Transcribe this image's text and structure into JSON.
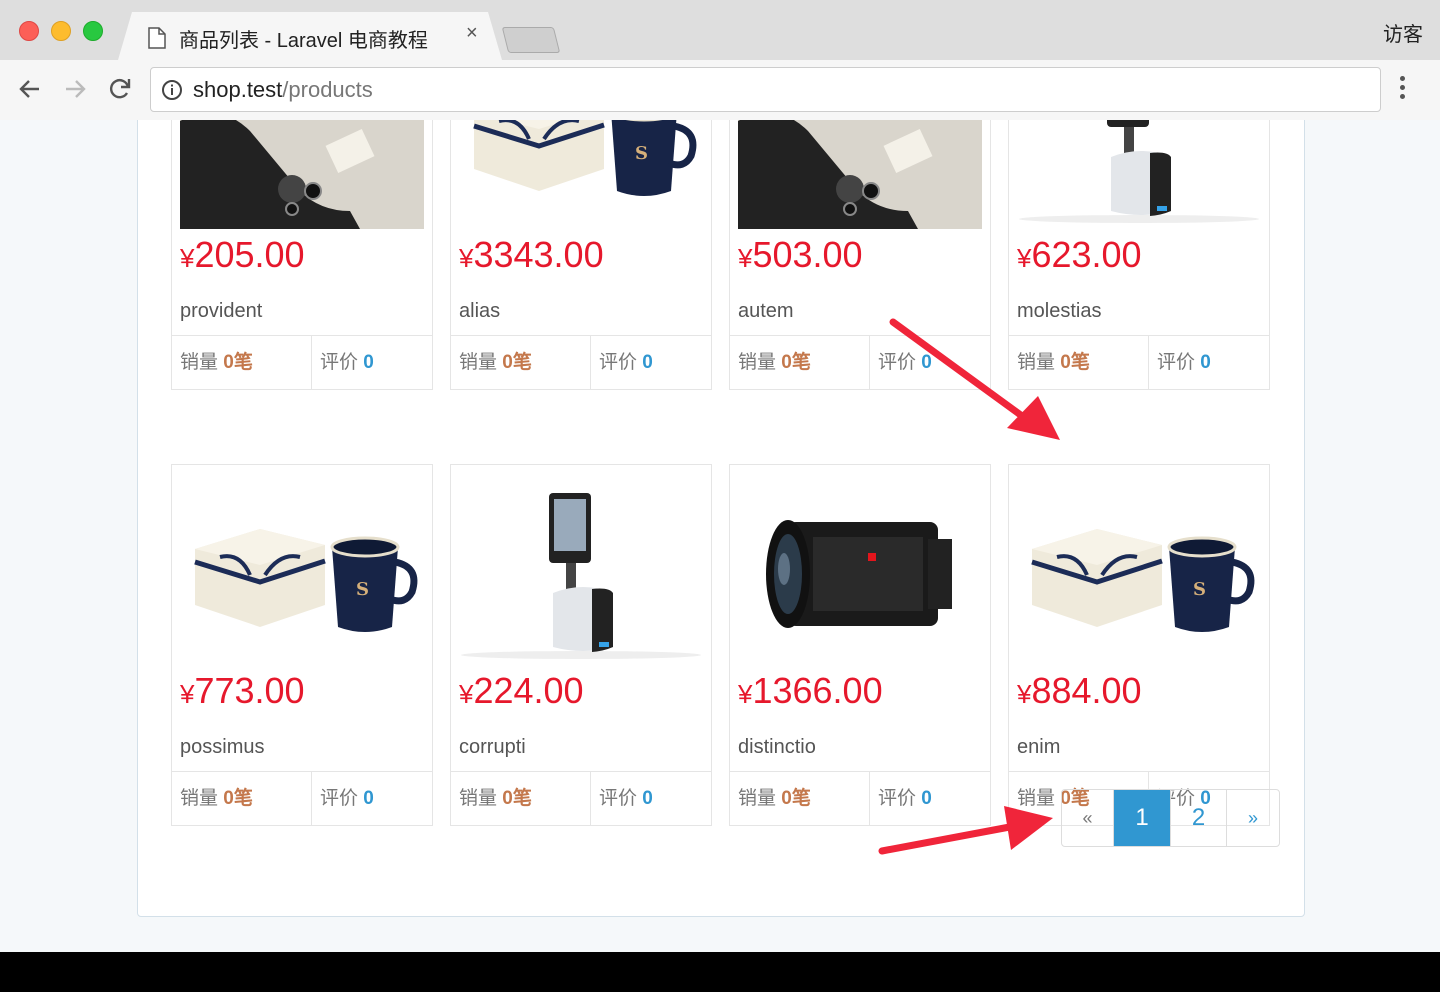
{
  "browser": {
    "tab_title": "商品列表 - Laravel 电商教程",
    "tab_close": "×",
    "guest_label": "访客",
    "url_host": "shop.test",
    "url_path": "/products"
  },
  "products": [
    {
      "price": "205.00",
      "name": "provident",
      "image": "camera-grip",
      "sold": "0笔",
      "reviews": "0"
    },
    {
      "price": "3343.00",
      "name": "alias",
      "image": "gift-mug",
      "sold": "0笔",
      "reviews": "0"
    },
    {
      "price": "503.00",
      "name": "autem",
      "image": "camera-grip",
      "sold": "0笔",
      "reviews": "0"
    },
    {
      "price": "623.00",
      "name": "molestias",
      "image": "tablet-stand",
      "sold": "0笔",
      "reviews": "0"
    },
    {
      "price": "773.00",
      "name": "possimus",
      "image": "gift-mug",
      "sold": "0笔",
      "reviews": "0"
    },
    {
      "price": "224.00",
      "name": "corrupti",
      "image": "tablet-stand",
      "sold": "0笔",
      "reviews": "0"
    },
    {
      "price": "1366.00",
      "name": "distinctio",
      "image": "camera-lens",
      "sold": "0笔",
      "reviews": "0"
    },
    {
      "price": "884.00",
      "name": "enim",
      "image": "gift-mug",
      "sold": "0笔",
      "reviews": "0"
    }
  ],
  "labels": {
    "currency": "¥",
    "sold": "销量",
    "reviews": "评价"
  },
  "pagination": {
    "prev": "«",
    "current": "1",
    "page2": "2",
    "next": "»"
  },
  "colors": {
    "price": "#e6182c",
    "accent": "#3097d1",
    "sold": "#c4784c",
    "arrow": "#f0253a"
  }
}
